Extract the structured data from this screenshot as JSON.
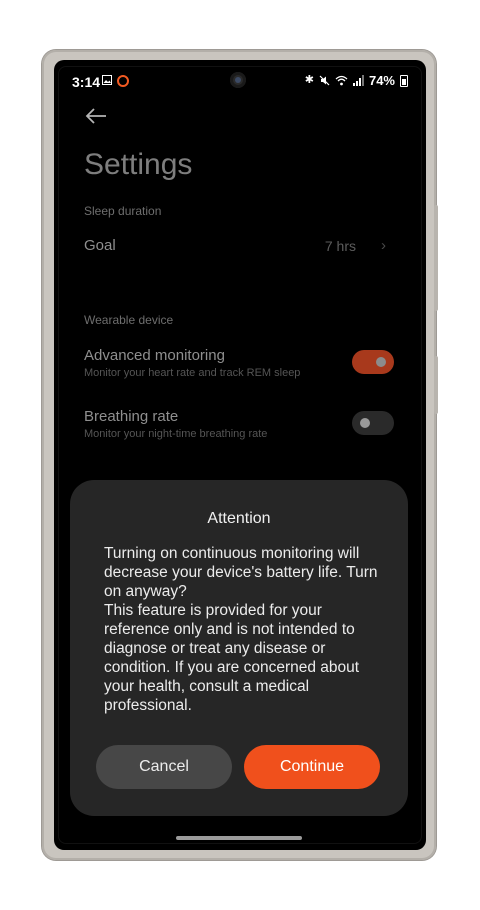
{
  "status_bar": {
    "time": "3:14",
    "battery": "74%",
    "icons": [
      "gallery-icon",
      "ring-icon",
      "bluetooth-icon",
      "mute-icon",
      "wifi-icon",
      "signal-icon",
      "battery-icon"
    ]
  },
  "page": {
    "title": "Settings",
    "sleep_section": {
      "label": "Sleep duration",
      "goal": {
        "title": "Goal",
        "value": "7 hrs"
      }
    },
    "wearable_section": {
      "label": "Wearable device",
      "advanced_monitoring": {
        "title": "Advanced monitoring",
        "subtitle": "Monitor your heart rate and track REM sleep",
        "enabled": true
      },
      "breathing_rate": {
        "title": "Breathing rate",
        "subtitle": "Monitor your night-time breathing rate",
        "enabled": false
      }
    }
  },
  "dialog": {
    "title": "Attention",
    "body": "Turning on continuous monitoring will decrease your device's battery life. Turn on anyway?\nThis feature is provided for your reference only and is not intended to diagnose or treat any disease or condition. If you are concerned about your health, consult a medical professional.",
    "cancel_label": "Cancel",
    "continue_label": "Continue"
  },
  "colors": {
    "accent": "#f0501c",
    "toggle_on": "#a8391c",
    "dialog_bg": "#262626"
  }
}
